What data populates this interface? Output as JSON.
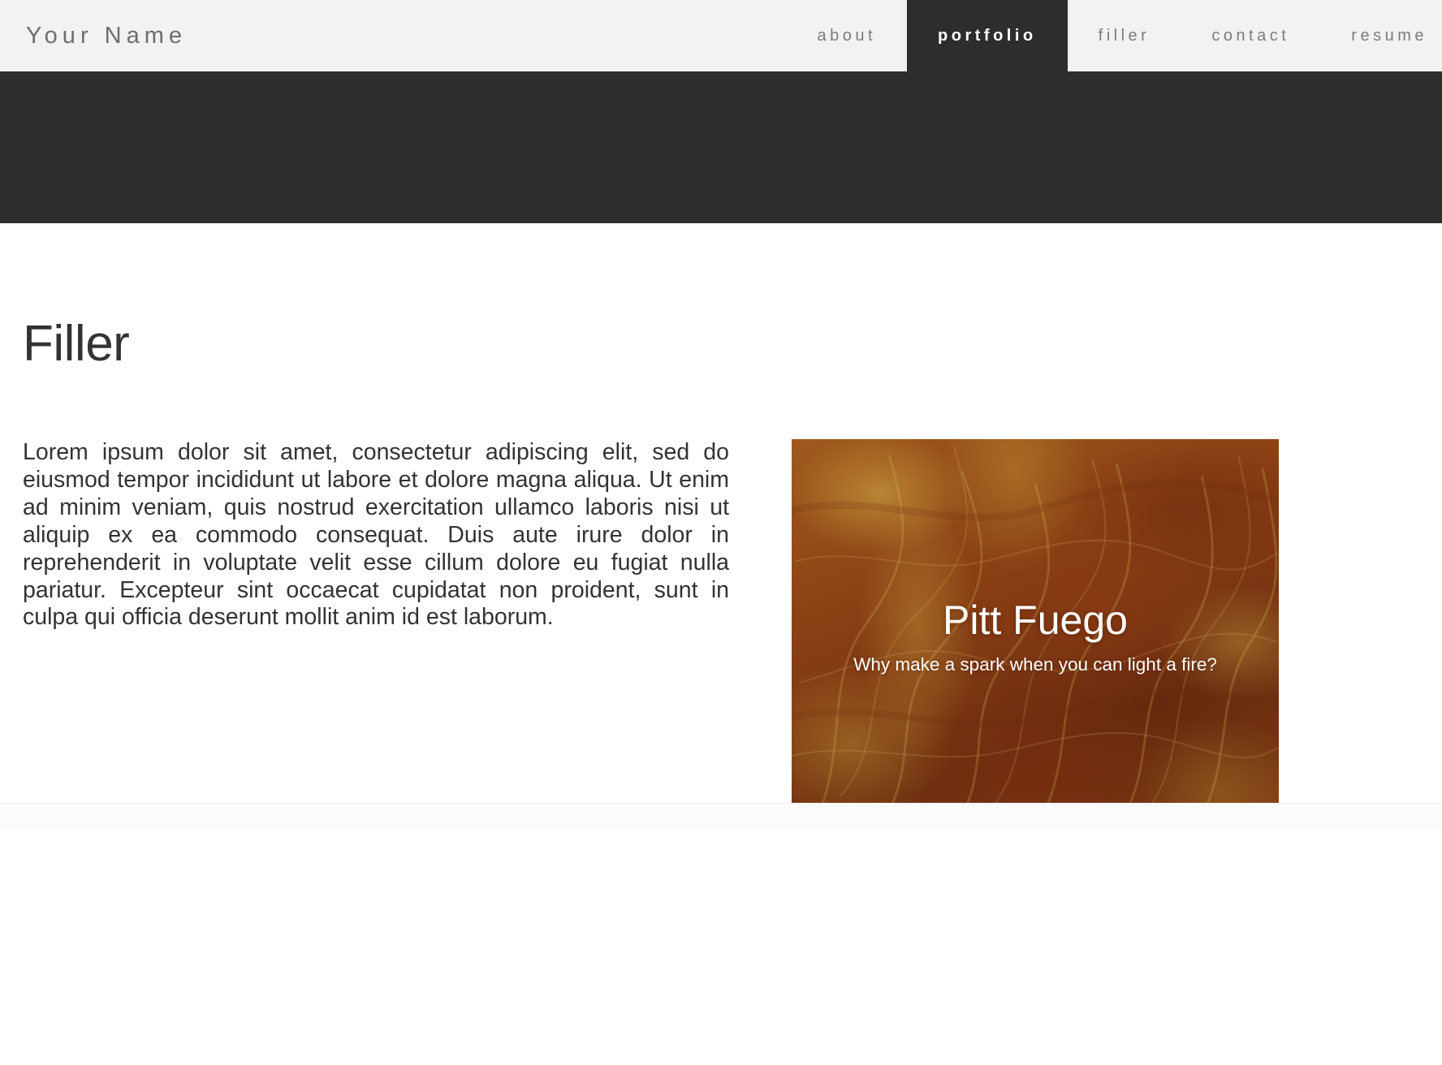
{
  "header": {
    "brand": "Your Name",
    "nav": [
      {
        "label": "about",
        "active": false
      },
      {
        "label": "portfolio",
        "active": true
      },
      {
        "label": "filler",
        "active": false
      },
      {
        "label": "contact",
        "active": false
      },
      {
        "label": "resume",
        "active": false
      }
    ]
  },
  "main": {
    "page_title": "Filler",
    "body_text": "Lorem ipsum dolor sit amet, consectetur adipiscing elit, sed do eiusmod tempor incididunt ut labore et dolore magna aliqua. Ut enim ad minim veniam, quis nostrud exercitation ullamco laboris nisi ut aliquip ex ea commodo consequat. Duis aute irure dolor in reprehenderit in voluptate velit esse cillum dolore eu fugiat nulla pariatur. Excepteur sint occaecat cupidatat non proident, sunt in culpa qui officia deserunt mollit anim id est laborum."
  },
  "card": {
    "title": "Pitt Fuego",
    "subtitle": "Why make a spark when you can light a fire?",
    "image_alt": "fire-flames-background"
  },
  "colors": {
    "header_bg": "#f2f2f2",
    "hero_bg": "#2d2d2d",
    "active_nav_bg": "#2d2d2d",
    "text_dark": "#333333",
    "text_muted": "#7b7b7b",
    "card_flame": "#8d4418",
    "page_bg": "#ffffff"
  }
}
